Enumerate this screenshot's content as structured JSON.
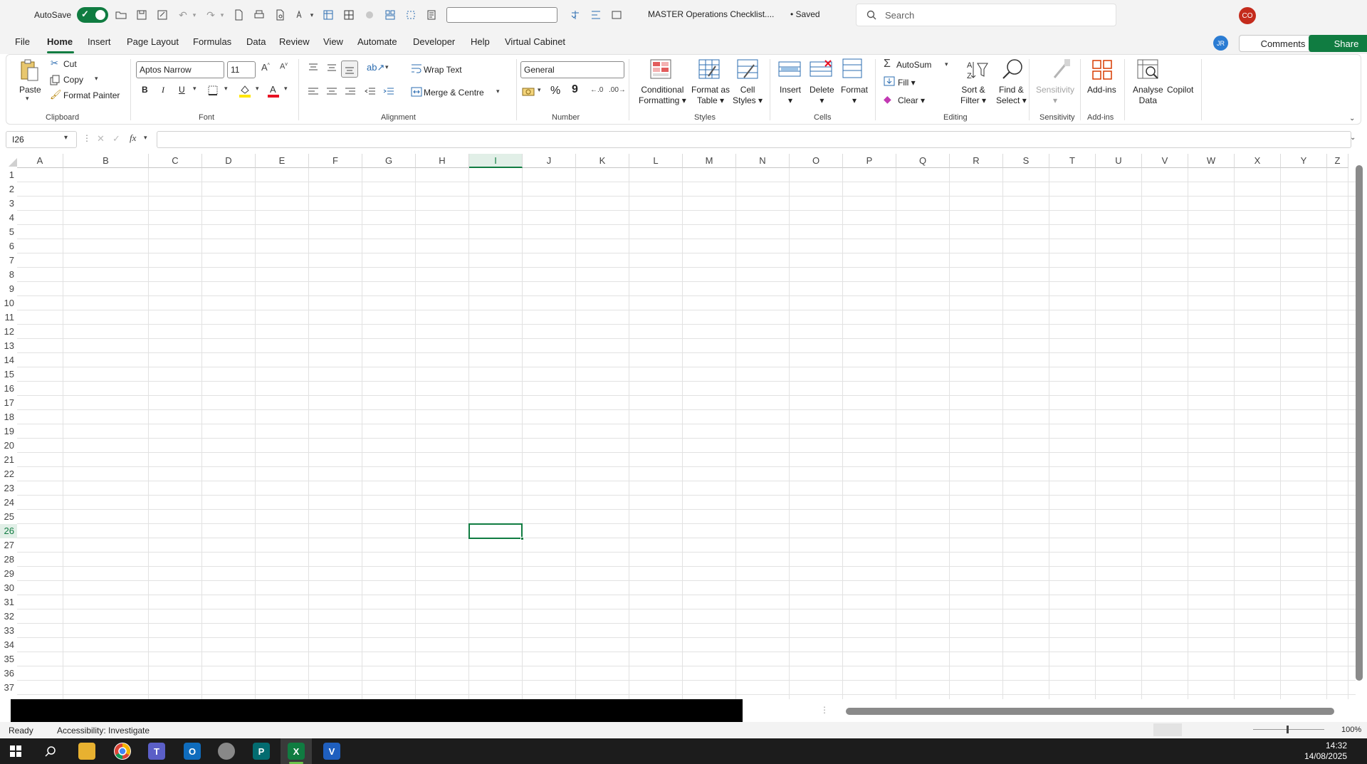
{
  "titlebar": {
    "autosave_label": "AutoSave",
    "document_title": "MASTER Operations Checklist....",
    "save_status": "• Saved",
    "search_placeholder": "Search",
    "user_initials": "CO"
  },
  "menu": {
    "tabs": [
      "File",
      "Home",
      "Insert",
      "Page Layout",
      "Formulas",
      "Data",
      "Review",
      "View",
      "Automate",
      "Developer",
      "Help",
      "Virtual Cabinet"
    ],
    "active_tab": "Home",
    "account_initials": "JR",
    "comments_label": "Comments",
    "share_label": "Share"
  },
  "ribbon": {
    "clipboard": {
      "label": "Clipboard",
      "paste": "Paste",
      "cut": "Cut",
      "copy": "Copy",
      "format_painter": "Format Painter"
    },
    "font": {
      "label": "Font",
      "font_name": "Aptos Narrow",
      "font_size": "11",
      "bold": "B",
      "italic": "I",
      "underline": "U"
    },
    "alignment": {
      "label": "Alignment",
      "wrap_text": "Wrap Text",
      "merge_centre": "Merge & Centre"
    },
    "number": {
      "label": "Number",
      "format": "General",
      "percent": "%",
      "comma": "9"
    },
    "styles": {
      "label": "Styles",
      "conditional_1": "Conditional",
      "conditional_2": "Formatting",
      "format_table_1": "Format as",
      "format_table_2": "Table",
      "cell_styles_1": "Cell",
      "cell_styles_2": "Styles"
    },
    "cells": {
      "label": "Cells",
      "insert": "Insert",
      "delete": "Delete",
      "format": "Format"
    },
    "editing": {
      "label": "Editing",
      "autosum": "AutoSum",
      "fill": "Fill",
      "clear": "Clear",
      "sort_1": "Sort &",
      "sort_2": "Filter",
      "find_1": "Find &",
      "find_2": "Select"
    },
    "sensitivity": {
      "label": "Sensitivity",
      "button": "Sensitivity"
    },
    "addins": {
      "label": "Add-ins",
      "button": "Add-ins"
    },
    "analyse_1": "Analyse",
    "analyse_2": "Data",
    "copilot": "Copilot"
  },
  "formula_bar": {
    "name_box": "I26",
    "fx": "fx",
    "content": ""
  },
  "grid": {
    "columns": [
      "A",
      "B",
      "C",
      "D",
      "E",
      "F",
      "G",
      "H",
      "I",
      "J",
      "K",
      "L",
      "M",
      "N",
      "O",
      "P",
      "Q",
      "R",
      "S",
      "T",
      "U",
      "V",
      "W",
      "X",
      "Y",
      "Z"
    ],
    "rows": [
      "1",
      "2",
      "3",
      "4",
      "5",
      "6",
      "7",
      "8",
      "9",
      "10",
      "11",
      "12",
      "13",
      "14",
      "15",
      "16",
      "17",
      "18",
      "19",
      "20",
      "21",
      "22",
      "23",
      "24",
      "25",
      "26",
      "27",
      "28",
      "29",
      "30",
      "31",
      "32",
      "33",
      "34",
      "35",
      "36",
      "37"
    ],
    "selected_column": "I",
    "selected_row": "26"
  },
  "statusbar": {
    "ready": "Ready",
    "accessibility": "Accessibility: Investigate",
    "zoom": "100%"
  },
  "taskbar": {
    "time": "14:32",
    "date": "14/08/2025"
  },
  "colors": {
    "accent": "#107c41",
    "share": "#107c41",
    "avatar_co": "#c42b1c",
    "avatar_jr": "#2b7cd3"
  }
}
